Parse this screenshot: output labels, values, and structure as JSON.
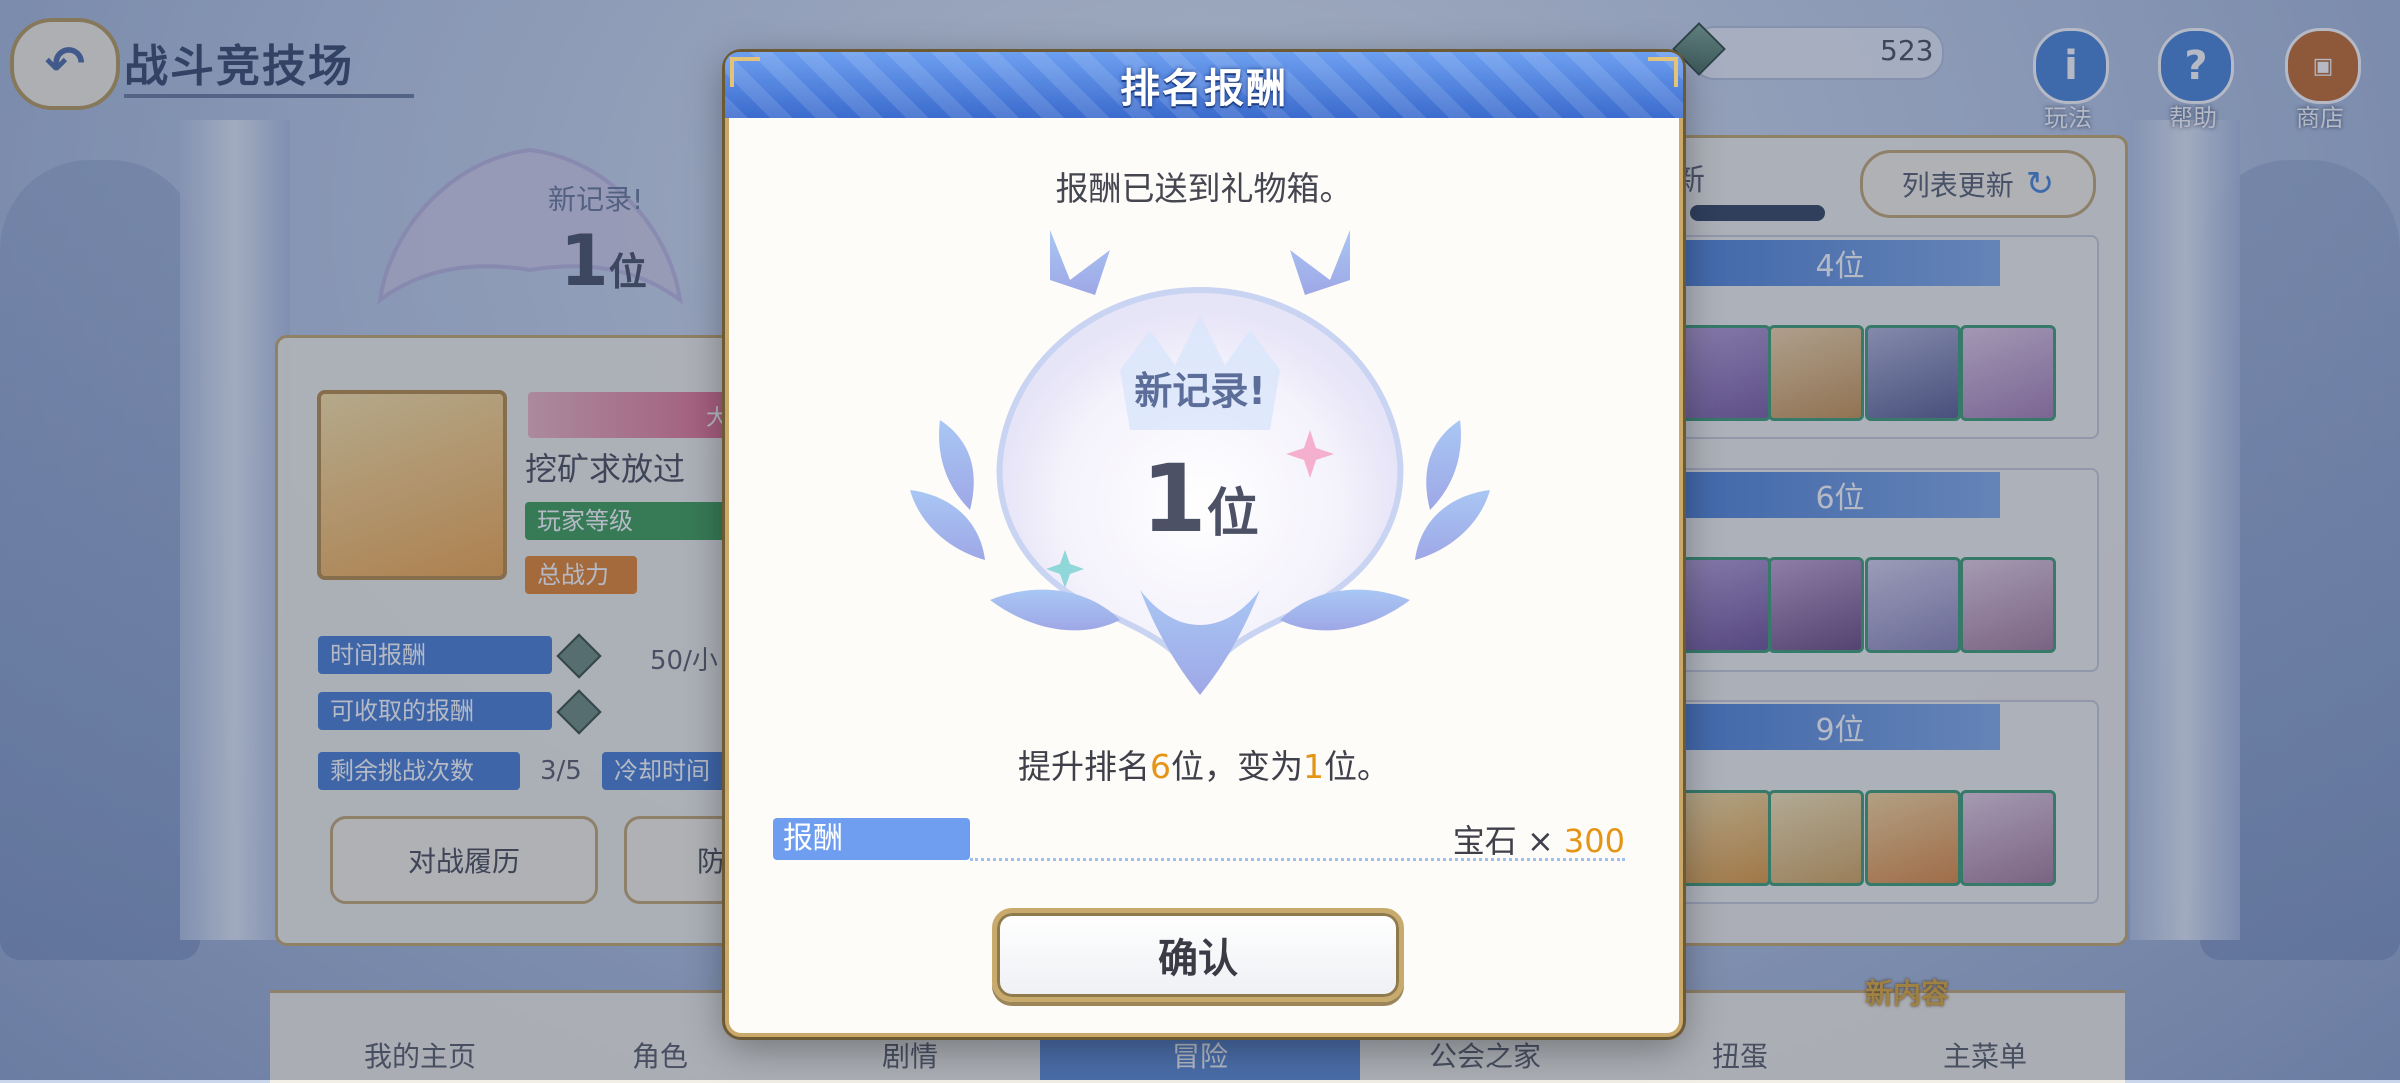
{
  "screen": {
    "page_title": "战斗竞技场",
    "back_icon": "back-arrow-icon",
    "currency": {
      "icon": "jewel-icon",
      "count": "523"
    },
    "top_buttons": [
      {
        "label": "玩法",
        "icon": "info-icon",
        "color": "#4a86d8"
      },
      {
        "label": "帮助",
        "icon": "help-icon",
        "color": "#4a86d8"
      },
      {
        "label": "商店",
        "icon": "shop-icon",
        "color": "#c56a2c"
      }
    ]
  },
  "left_panel": {
    "new_record_label": "新记录!",
    "rank_value": "1",
    "rank_suffix": "位",
    "player_name": "挖矿求放过",
    "badge_text": "大",
    "player_level_label": "玩家等级",
    "total_power_label": "总战力",
    "time_reward_label": "时间报酬",
    "time_reward_value": "50/小",
    "collectable_reward_label": "可收取的报酬",
    "remaining_challenges_label": "剩余挑战次数",
    "remaining_challenges_value": "3/5",
    "cooldown_label": "冷却时间",
    "battle_history_button": "对战履历",
    "defense_button": "防"
  },
  "right_panel": {
    "header_fragment": "新",
    "refresh_button": "列表更新",
    "opponents": [
      {
        "rank": "4位"
      },
      {
        "rank": "6位"
      },
      {
        "rank": "9位"
      }
    ]
  },
  "bottom_nav": {
    "items": [
      {
        "label": "我的主页"
      },
      {
        "label": "角色"
      },
      {
        "label": "剧情"
      },
      {
        "label": "冒险",
        "active": true
      },
      {
        "label": "公会之家"
      },
      {
        "label": "扭蛋"
      },
      {
        "label": "主菜单"
      }
    ],
    "new_content_badge": "新内容"
  },
  "modal": {
    "title": "排名报酬",
    "message": "报酬已送到礼物箱。",
    "new_record": "新记录!",
    "rank_number": "1",
    "rank_suffix": "位",
    "result_prefix": "提升排名",
    "result_up": "6",
    "result_mid": "位，变为",
    "result_rank": "1",
    "result_suffix": "位。",
    "reward_label": "报酬",
    "reward_item": "宝石",
    "reward_times": "×",
    "reward_qty": "300",
    "confirm_button": "确认"
  }
}
